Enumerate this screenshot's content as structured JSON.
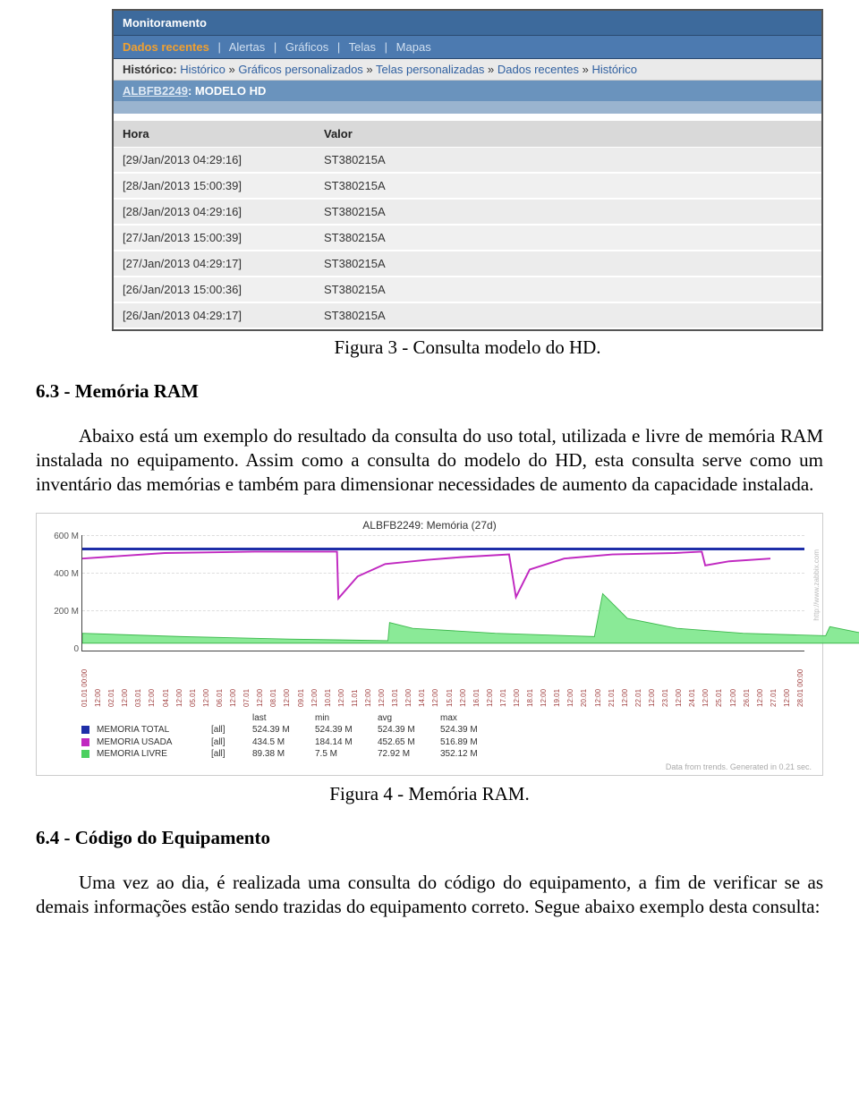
{
  "zabbix": {
    "main_tab": "Monitoramento",
    "subtabs": {
      "active": "Dados recentes",
      "others": [
        "Alertas",
        "Gráficos",
        "Telas",
        "Mapas"
      ]
    },
    "breadcrumb": {
      "label": "Histórico:",
      "items": [
        "Histórico",
        "Gráficos personalizados",
        "Telas personalizadas",
        "Dados recentes",
        "Histórico"
      ]
    },
    "host": "ALBFB2249",
    "item": "MODELO HD",
    "table": {
      "headers": {
        "hora": "Hora",
        "valor": "Valor"
      },
      "rows": [
        {
          "hora": "[29/Jan/2013 04:29:16]",
          "valor": "ST380215A"
        },
        {
          "hora": "[28/Jan/2013 15:00:39]",
          "valor": "ST380215A"
        },
        {
          "hora": "[28/Jan/2013 04:29:16]",
          "valor": "ST380215A"
        },
        {
          "hora": "[27/Jan/2013 15:00:39]",
          "valor": "ST380215A"
        },
        {
          "hora": "[27/Jan/2013 04:29:17]",
          "valor": "ST380215A"
        },
        {
          "hora": "[26/Jan/2013 15:00:36]",
          "valor": "ST380215A"
        },
        {
          "hora": "[26/Jan/2013 04:29:17]",
          "valor": "ST380215A"
        }
      ]
    }
  },
  "caption_fig3": "Figura 3 - Consulta modelo do HD.",
  "heading_63": "6.3 - Memória RAM",
  "para_63": "Abaixo está um exemplo do resultado da consulta do uso total, utilizada e livre de memória RAM instalada no equipamento. Assim como a consulta do modelo do HD, esta consulta serve como um inventário das memórias e também para dimensionar necessidades de aumento da capacidade instalada.",
  "chart_data": {
    "type": "line",
    "title": "ALBFB2249: Memória (27d)",
    "ylabel": "",
    "xlabel": "",
    "ylim": [
      0,
      650
    ],
    "y_ticks": [
      "0",
      "200 M",
      "400 M",
      "600 M"
    ],
    "x_ticks": [
      "01.01 00:00",
      "12:00",
      "02.01",
      "12:00",
      "03.01",
      "12:00",
      "04.01",
      "12:00",
      "05.01",
      "12:00",
      "06.01",
      "12:00",
      "07.01",
      "12:00",
      "08.01",
      "12:00",
      "09.01",
      "12:00",
      "10.01",
      "12:00",
      "11.01",
      "12:00",
      "12:00",
      "13.01",
      "12:00",
      "14.01",
      "12:00",
      "15.01",
      "12:00",
      "16.01",
      "12:00",
      "17.01",
      "12:00",
      "18.01",
      "12:00",
      "19.01",
      "12:00",
      "20.01",
      "12:00",
      "21.01",
      "12:00",
      "22.01",
      "12:00",
      "23.01",
      "12:00",
      "24.01",
      "12:00",
      "25.01",
      "12:00",
      "26.01",
      "12:00",
      "27.01",
      "12:00",
      "28.01 00:00"
    ],
    "series": [
      {
        "name": "MEMORIA TOTAL",
        "color": "#1e2ea8",
        "all": "[all]",
        "last": "524.39 M",
        "min": "524.39 M",
        "avg": "524.39 M",
        "max": "524.39 M"
      },
      {
        "name": "MEMORIA USADA",
        "color": "#c028c0",
        "all": "[all]",
        "last": "434.5 M",
        "min": "184.14 M",
        "avg": "452.65 M",
        "max": "516.89 M"
      },
      {
        "name": "MEMORIA LIVRE",
        "color": "#4cd060",
        "all": "[all]",
        "last": "89.38 M",
        "min": "7.5 M",
        "avg": "72.92 M",
        "max": "352.12 M"
      }
    ],
    "legend_headers": {
      "last": "last",
      "min": "min",
      "avg": "avg",
      "max": "max"
    },
    "footer": "Data from trends. Generated in 0.21 sec.",
    "watermark": "http://www.zabbix.com"
  },
  "caption_fig4": "Figura 4 - Memória RAM.",
  "heading_64": "6.4 - Código do Equipamento",
  "para_64": "Uma vez ao dia, é realizada uma consulta do código do equipamento, a fim de verificar se as demais informações estão sendo trazidas do equipamento correto. Segue abaixo exemplo desta consulta:"
}
